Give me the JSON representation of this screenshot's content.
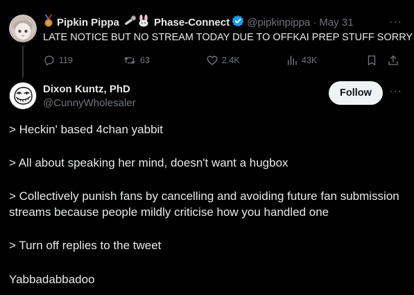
{
  "parent_tweet": {
    "display_name": "Pipkin Pippa",
    "collab_name": "Phase-Connect",
    "handle": "@pipkinpippa",
    "separator": "·",
    "date": "May 31",
    "text": "LATE NOTICE BUT NO STREAM TODAY DUE TO OFFKAI PREP STUFF SORRY ;;",
    "more": "···",
    "stats": {
      "replies": "119",
      "retweets": "63",
      "likes": "2.4K",
      "views": "43K"
    }
  },
  "reply": {
    "display_name": "Dixon Kuntz, PhD",
    "handle": "@CunnyWholesaler",
    "follow_label": "Follow",
    "more": "···",
    "lines": [
      "> Heckin' based 4chan yabbit",
      "> All about speaking her mind, doesn't want a hugbox",
      "> Collectively punish fans by cancelling and avoiding future fan submission",
      "streams because people mildly criticise how you handled one",
      "> Turn off replies to the tweet",
      "Yabbadabbadoo"
    ]
  },
  "colors": {
    "background": "#000000",
    "text_primary": "#e7e9ea",
    "text_secondary": "#71767b",
    "verified_blue": "#1d9bf0",
    "follow_bg": "#eff3f4",
    "thread_line": "#333639"
  },
  "icons": [
    "bronze-medal-icon",
    "microphone-icon",
    "rabbit-icon",
    "verified-badge-icon",
    "reply-icon",
    "retweet-icon",
    "like-icon",
    "views-icon",
    "bookmark-icon",
    "share-icon",
    "more-icon"
  ]
}
